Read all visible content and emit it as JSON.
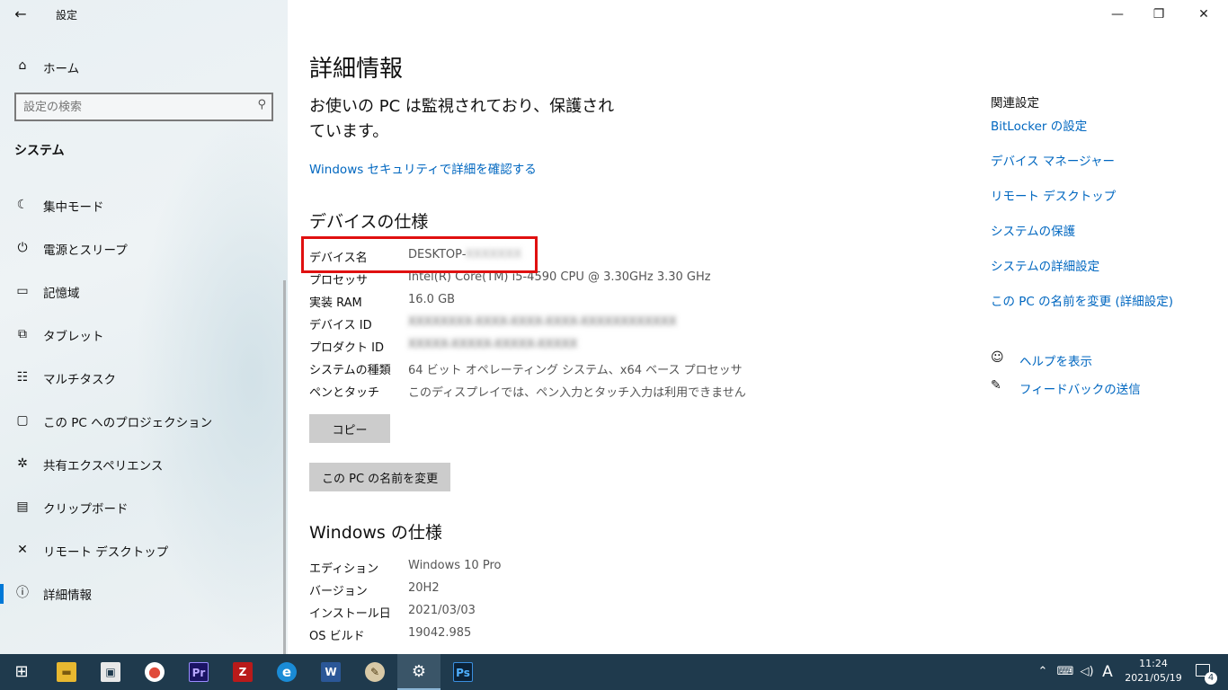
{
  "window": {
    "app_title": "設定",
    "back_icon": "←",
    "minimize_icon": "—",
    "maximize_icon": "❐",
    "close_icon": "✕"
  },
  "sidebar": {
    "home": {
      "icon": "⌂",
      "label": "ホーム"
    },
    "search": {
      "placeholder": "設定の検索",
      "icon": "⚲"
    },
    "section_title": "システム",
    "items": [
      {
        "icon": "☾",
        "label": "集中モード"
      },
      {
        "icon": "⏻",
        "label": "電源とスリープ"
      },
      {
        "icon": "▭",
        "label": "記憶域"
      },
      {
        "icon": "⧉",
        "label": "タブレット"
      },
      {
        "icon": "☷",
        "label": "マルチタスク"
      },
      {
        "icon": "▢",
        "label": "この PC へのプロジェクション"
      },
      {
        "icon": "✲",
        "label": "共有エクスペリエンス"
      },
      {
        "icon": "▤",
        "label": "クリップボード"
      },
      {
        "icon": "✕",
        "label": "リモート デスクトップ"
      },
      {
        "icon": "ⓘ",
        "label": "詳細情報"
      }
    ]
  },
  "main": {
    "title": "詳細情報",
    "protect_msg": "お使いの PC は監視されており、保護されています。",
    "security_link": "Windows セキュリティで詳細を確認する",
    "device_specs_title": "デバイスの仕様",
    "device_specs": [
      {
        "key": "デバイス名",
        "value": "DESKTOP-",
        "hidden": "XXXXXXX"
      },
      {
        "key": "プロセッサ",
        "value": "Intel(R) Core(TM) i5-4590 CPU @ 3.30GHz   3.30 GHz"
      },
      {
        "key": "実装 RAM",
        "value": "16.0 GB"
      },
      {
        "key": "デバイス ID",
        "value": "",
        "hidden": "XXXXXXXX-XXXX-XXXX-XXXX-XXXXXXXXXXXX"
      },
      {
        "key": "プロダクト ID",
        "value": "",
        "hidden": "XXXXX-XXXXX-XXXXX-XXXXX"
      },
      {
        "key": "システムの種類",
        "value": "64 ビット オペレーティング システム、x64 ベース プロセッサ"
      },
      {
        "key": "ペンとタッチ",
        "value": "このディスプレイでは、ペン入力とタッチ入力は利用できません"
      }
    ],
    "copy_button": "コピー",
    "rename_button": "この PC の名前を変更",
    "windows_specs_title": "Windows の仕様",
    "windows_specs": [
      {
        "key": "エディション",
        "value": "Windows 10 Pro"
      },
      {
        "key": "バージョン",
        "value": "20H2"
      },
      {
        "key": "インストール日",
        "value": "2021/03/03"
      },
      {
        "key": "OS ビルド",
        "value": "19042.985"
      }
    ]
  },
  "related": {
    "title": "関連設定",
    "links": [
      "BitLocker の設定",
      "デバイス マネージャー",
      "リモート デスクトップ",
      "システムの保護",
      "システムの詳細設定",
      "この PC の名前を変更 (詳細設定)"
    ],
    "help": {
      "icon": "☺",
      "label": "ヘルプを表示"
    },
    "feedback": {
      "icon": "✎",
      "label": "フィードバックの送信"
    }
  },
  "taskbar": {
    "start_icon": "⊞",
    "apps": [
      {
        "name": "file-explorer",
        "glyph": "▬",
        "color": "#e8b830"
      },
      {
        "name": "store",
        "glyph": "▣",
        "color": "#e8e8e8"
      },
      {
        "name": "chrome",
        "glyph": "●",
        "color": "#e04a3a"
      },
      {
        "name": "premiere",
        "glyph": "Pr",
        "color": "#1b1464"
      },
      {
        "name": "filezilla",
        "glyph": "Z",
        "color": "#b91a1a"
      },
      {
        "name": "edge",
        "glyph": "e",
        "color": "#1a8bd6"
      },
      {
        "name": "word",
        "glyph": "W",
        "color": "#2b5797"
      },
      {
        "name": "paint",
        "glyph": "✎",
        "color": "#4f8fcf"
      },
      {
        "name": "settings",
        "glyph": "⚙",
        "color": "#3a5568"
      },
      {
        "name": "photoshop",
        "glyph": "Ps",
        "color": "#0b2238"
      }
    ],
    "tray": {
      "chevron": "⌃",
      "network": "⌨",
      "volume": "◁)",
      "ime": "A"
    },
    "time": "11:24",
    "date": "2021/05/19",
    "notifications": "4"
  }
}
